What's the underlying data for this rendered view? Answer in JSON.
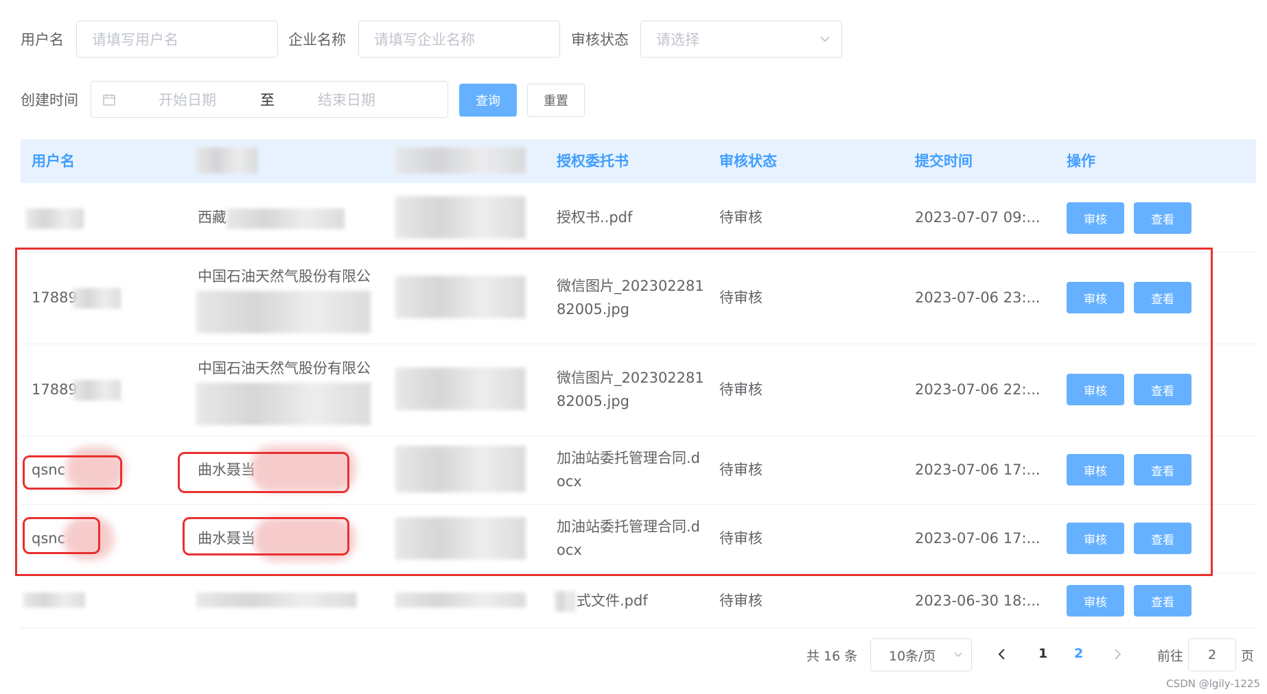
{
  "filters": {
    "username_label": "用户名",
    "username_placeholder": "请填写用户名",
    "company_label": "企业名称",
    "company_placeholder": "请填写企业名称",
    "status_label": "审核状态",
    "status_placeholder": "请选择",
    "created_label": "创建时间",
    "start_placeholder": "开始日期",
    "range_separator": "至",
    "end_placeholder": "结束日期",
    "query_button": "查询",
    "reset_button": "重置"
  },
  "table": {
    "headers": [
      "用户名",
      "",
      "",
      "授权委托书",
      "审核状态",
      "提交时间",
      "操作"
    ],
    "rows": [
      {
        "username": "",
        "company": "西藏",
        "file_line1": "授权书..pdf",
        "file_line2": "",
        "status": "待审核",
        "time": "2023-07-07 09:...",
        "audit": "审核",
        "view": "查看"
      },
      {
        "username": "17889",
        "company": "中国石油天然气股份有限公",
        "file_line1": "微信图片_202302281",
        "file_line2": "82005.jpg",
        "status": "待审核",
        "time": "2023-07-06 23:...",
        "audit": "审核",
        "view": "查看"
      },
      {
        "username": "17889",
        "company": "中国石油天然气股份有限公",
        "file_line1": "微信图片_202302281",
        "file_line2": "82005.jpg",
        "status": "待审核",
        "time": "2023-07-06 22:...",
        "audit": "审核",
        "view": "查看"
      },
      {
        "username": "qsnc",
        "company": "曲水聂当",
        "file_line1": "加油站委托管理合同.d",
        "file_line2": "ocx",
        "status": "待审核",
        "time": "2023-07-06 17:...",
        "audit": "审核",
        "view": "查看"
      },
      {
        "username": "qsnc",
        "company": "曲水聂当",
        "file_line1": "加油站委托管理合同.d",
        "file_line2": "ocx",
        "status": "待审核",
        "time": "2023-07-06 17:...",
        "audit": "审核",
        "view": "查看"
      },
      {
        "username": "",
        "company": "",
        "file_line1": "式文件.pdf",
        "file_line2": "",
        "status": "待审核",
        "time": "2023-06-30 18:...",
        "audit": "审核",
        "view": "查看"
      }
    ]
  },
  "pagination": {
    "total_text": "共 16 条",
    "page_size": "10条/页",
    "page1": "1",
    "page2": "2",
    "goto_label": "前往",
    "goto_value": "2",
    "page_suffix": "页"
  },
  "watermark": "CSDN @lgily-1225",
  "colors": {
    "accent": "#409eff",
    "button": "#66b1ff",
    "header_bg": "#e8f2fe",
    "annotation": "#e8302f"
  }
}
